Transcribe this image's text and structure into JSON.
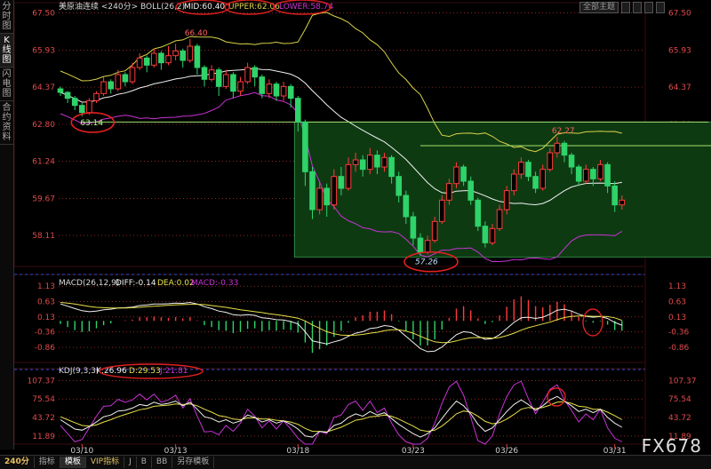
{
  "sidebar_tabs": [
    {
      "label": "分时图",
      "active": false
    },
    {
      "label": "K线图",
      "active": true
    },
    {
      "label": "闪电图",
      "active": false
    },
    {
      "label": "合约资料",
      "active": false
    }
  ],
  "top_controls": {
    "theme_label": "全部主题"
  },
  "bottom_tabs": [
    {
      "label": "240分",
      "kind": "period"
    },
    {
      "label": "指标",
      "kind": "normal"
    },
    {
      "label": "模板",
      "kind": "active"
    },
    {
      "label": "VIP指标",
      "kind": "vip"
    },
    {
      "label": "J",
      "kind": "normal"
    },
    {
      "label": "B",
      "kind": "normal"
    },
    {
      "label": "BB",
      "kind": "normal"
    },
    {
      "label": "另存模板",
      "kind": "normal"
    }
  ],
  "watermark": "FX678",
  "colors": {
    "up": "#ff3b3b",
    "down": "#2fd36a",
    "mid": "#f0f0f0",
    "upper": "#d9d24a",
    "lower": "#c833d6",
    "dif": "#f0f0f0",
    "dea": "#e8e04a",
    "kdj_k": "#f0f0f0",
    "kdj_d": "#e8e04a",
    "kdj_j": "#c833d6",
    "annot": "#e02020",
    "box": "#0e3a12",
    "hline": "#9ee06a"
  },
  "chart_data": [
    {
      "type": "candlestick",
      "title": "美原油连续 <240分> BOLL(26,2)",
      "legend": [
        {
          "label": "MID:60.40",
          "color_key": "mid"
        },
        {
          "label": "UPPER:62.06",
          "color_key": "upper"
        },
        {
          "label": "LOWER:58.74",
          "color_key": "lower"
        }
      ],
      "yticks": [
        "67.50",
        "65.93",
        "64.37",
        "62.80",
        "61.24",
        "59.67",
        "58.11"
      ],
      "ytick_values": [
        67.5,
        65.93,
        64.37,
        62.8,
        61.24,
        59.67,
        58.11
      ],
      "ylim": [
        56.8,
        67.6
      ],
      "dates": [
        "03/10",
        "03/13",
        "03/18",
        "03/23",
        "03/26",
        "03/31"
      ],
      "date_index": [
        3,
        16,
        33,
        49,
        62,
        77
      ],
      "candles": [
        [
          64.3,
          64.15,
          64.4,
          64.0
        ],
        [
          64.15,
          63.9,
          64.2,
          63.7
        ],
        [
          63.9,
          63.6,
          64.0,
          63.4
        ],
        [
          63.6,
          63.3,
          63.7,
          63.14
        ],
        [
          63.3,
          63.8,
          63.9,
          63.2
        ],
        [
          63.8,
          64.1,
          64.2,
          63.7
        ],
        [
          64.1,
          64.6,
          64.8,
          64.0
        ],
        [
          64.6,
          64.3,
          64.7,
          64.1
        ],
        [
          64.3,
          64.9,
          65.1,
          64.2
        ],
        [
          64.9,
          64.6,
          65.0,
          64.4
        ],
        [
          64.6,
          65.2,
          65.4,
          64.5
        ],
        [
          65.2,
          65.6,
          65.8,
          65.1
        ],
        [
          65.6,
          65.3,
          65.7,
          65.0
        ],
        [
          65.3,
          65.8,
          66.0,
          65.2
        ],
        [
          65.8,
          65.4,
          65.9,
          65.1
        ],
        [
          65.4,
          65.7,
          66.1,
          65.3
        ],
        [
          65.7,
          65.9,
          66.2,
          65.5
        ],
        [
          65.9,
          65.5,
          66.0,
          65.2
        ],
        [
          65.5,
          66.1,
          66.4,
          65.4
        ],
        [
          66.1,
          65.2,
          66.2,
          64.9
        ],
        [
          65.2,
          64.7,
          65.3,
          64.4
        ],
        [
          64.7,
          65.1,
          65.3,
          64.6
        ],
        [
          65.1,
          64.4,
          65.2,
          64.0
        ],
        [
          64.4,
          64.9,
          65.1,
          64.3
        ],
        [
          64.9,
          64.2,
          65.0,
          63.9
        ],
        [
          64.2,
          64.6,
          64.8,
          64.0
        ],
        [
          64.6,
          65.2,
          65.4,
          64.5
        ],
        [
          65.2,
          64.8,
          65.3,
          64.4
        ],
        [
          64.8,
          64.1,
          64.9,
          63.9
        ],
        [
          64.1,
          64.5,
          64.7,
          63.9
        ],
        [
          64.5,
          64.0,
          64.6,
          63.8
        ],
        [
          64.0,
          64.4,
          64.6,
          63.8
        ],
        [
          64.4,
          63.9,
          64.5,
          63.5
        ],
        [
          63.9,
          62.9,
          64.0,
          62.5
        ],
        [
          62.9,
          60.8,
          63.0,
          60.2
        ],
        [
          60.8,
          59.2,
          61.0,
          58.8
        ],
        [
          59.2,
          60.1,
          60.4,
          59.0
        ],
        [
          60.1,
          59.4,
          60.3,
          58.9
        ],
        [
          59.4,
          60.6,
          60.9,
          59.2
        ],
        [
          60.6,
          60.1,
          61.0,
          59.8
        ],
        [
          60.1,
          61.1,
          61.4,
          60.0
        ],
        [
          61.1,
          61.3,
          61.6,
          60.8
        ],
        [
          61.3,
          60.9,
          61.5,
          60.6
        ],
        [
          60.9,
          61.5,
          61.8,
          60.7
        ],
        [
          61.5,
          61.0,
          61.7,
          60.7
        ],
        [
          61.0,
          61.4,
          61.6,
          60.8
        ],
        [
          61.4,
          60.6,
          61.5,
          60.3
        ],
        [
          60.6,
          59.8,
          60.8,
          59.5
        ],
        [
          59.8,
          58.9,
          60.0,
          58.6
        ],
        [
          58.9,
          58.0,
          59.1,
          57.7
        ],
        [
          58.0,
          57.4,
          58.2,
          57.26
        ],
        [
          57.4,
          57.9,
          58.1,
          57.3
        ],
        [
          57.9,
          58.7,
          58.9,
          57.8
        ],
        [
          58.7,
          59.6,
          59.8,
          58.6
        ],
        [
          59.6,
          60.3,
          60.5,
          59.4
        ],
        [
          60.3,
          61.0,
          61.2,
          60.1
        ],
        [
          61.0,
          60.4,
          61.1,
          60.2
        ],
        [
          60.4,
          59.6,
          60.6,
          59.4
        ],
        [
          59.6,
          58.5,
          59.7,
          58.3
        ],
        [
          58.5,
          57.8,
          58.7,
          57.6
        ],
        [
          57.8,
          58.4,
          58.6,
          57.7
        ],
        [
          58.4,
          59.2,
          59.4,
          58.3
        ],
        [
          59.2,
          60.0,
          60.2,
          59.0
        ],
        [
          60.0,
          60.7,
          60.9,
          59.8
        ],
        [
          60.7,
          61.2,
          61.4,
          60.5
        ],
        [
          61.2,
          60.6,
          61.3,
          60.4
        ],
        [
          60.6,
          60.1,
          60.8,
          59.9
        ],
        [
          60.1,
          60.9,
          61.1,
          60.0
        ],
        [
          60.9,
          61.6,
          61.8,
          60.8
        ],
        [
          61.6,
          62.0,
          62.27,
          61.4
        ],
        [
          62.0,
          61.5,
          62.1,
          61.2
        ],
        [
          61.5,
          61.0,
          61.6,
          60.7
        ],
        [
          61.0,
          60.4,
          61.1,
          60.2
        ],
        [
          60.4,
          60.9,
          61.1,
          60.3
        ],
        [
          60.9,
          60.5,
          61.0,
          60.2
        ],
        [
          60.5,
          61.1,
          61.3,
          60.4
        ],
        [
          61.1,
          60.2,
          61.2,
          59.9
        ],
        [
          60.2,
          59.4,
          60.4,
          59.1
        ],
        [
          59.4,
          59.6,
          59.8,
          59.2
        ]
      ],
      "annotations": [
        {
          "label": "66.40",
          "index": 18,
          "price": 66.4
        },
        {
          "label": "63.14",
          "index": 3,
          "price": 63.14
        },
        {
          "label": "62.27",
          "index": 69,
          "price": 62.27
        },
        {
          "label": "57.26",
          "index": 50,
          "price": 57.26
        }
      ],
      "hlines": [
        {
          "price": 62.9,
          "from_index": 3,
          "to_index": 90
        },
        {
          "price": 61.9,
          "from_index": 50,
          "to_index": 95
        }
      ],
      "box": {
        "from_index": 33,
        "to_index": 92,
        "top": 62.9,
        "bottom": 57.2
      }
    },
    {
      "type": "macd",
      "title": "MACD(26,12,9)",
      "legend": [
        {
          "label": "DIFF:-0.14",
          "color_key": "dif"
        },
        {
          "label": "DEA:0.02",
          "color_key": "dea"
        },
        {
          "label": "MACD:-0.33",
          "color_key": "lower"
        }
      ],
      "yticks": [
        "1.13",
        "0.63",
        "0.13",
        "-0.36",
        "-0.86"
      ],
      "ytick_values": [
        1.13,
        0.63,
        0.13,
        -0.36,
        -0.86
      ],
      "ylim": [
        -1.35,
        1.25
      ],
      "dif": [
        0.55,
        0.48,
        0.4,
        0.33,
        0.3,
        0.32,
        0.36,
        0.38,
        0.42,
        0.43,
        0.45,
        0.5,
        0.52,
        0.55,
        0.55,
        0.56,
        0.58,
        0.57,
        0.6,
        0.55,
        0.46,
        0.4,
        0.32,
        0.28,
        0.2,
        0.18,
        0.2,
        0.18,
        0.1,
        0.08,
        0.04,
        0.03,
        -0.02,
        -0.1,
        -0.35,
        -0.65,
        -0.7,
        -0.75,
        -0.68,
        -0.62,
        -0.5,
        -0.4,
        -0.35,
        -0.25,
        -0.22,
        -0.15,
        -0.18,
        -0.3,
        -0.5,
        -0.7,
        -0.9,
        -1.0,
        -0.98,
        -0.85,
        -0.65,
        -0.45,
        -0.35,
        -0.38,
        -0.5,
        -0.6,
        -0.58,
        -0.45,
        -0.25,
        -0.05,
        0.1,
        0.12,
        0.08,
        0.12,
        0.22,
        0.35,
        0.38,
        0.32,
        0.22,
        0.15,
        0.12,
        0.14,
        0.08,
        -0.05,
        -0.14
      ],
      "dea": [
        0.6,
        0.58,
        0.55,
        0.51,
        0.47,
        0.44,
        0.43,
        0.42,
        0.42,
        0.42,
        0.43,
        0.44,
        0.46,
        0.48,
        0.49,
        0.51,
        0.52,
        0.53,
        0.54,
        0.54,
        0.53,
        0.5,
        0.47,
        0.44,
        0.4,
        0.36,
        0.33,
        0.3,
        0.27,
        0.23,
        0.2,
        0.17,
        0.13,
        0.09,
        0.0,
        -0.13,
        -0.24,
        -0.35,
        -0.42,
        -0.46,
        -0.47,
        -0.46,
        -0.44,
        -0.4,
        -0.37,
        -0.32,
        -0.29,
        -0.29,
        -0.33,
        -0.4,
        -0.5,
        -0.6,
        -0.68,
        -0.71,
        -0.7,
        -0.65,
        -0.59,
        -0.55,
        -0.54,
        -0.55,
        -0.56,
        -0.54,
        -0.48,
        -0.4,
        -0.3,
        -0.22,
        -0.16,
        -0.1,
        -0.04,
        0.04,
        0.11,
        0.15,
        0.16,
        0.16,
        0.15,
        0.15,
        0.14,
        0.1,
        0.02
      ]
    },
    {
      "type": "kdj",
      "title": "KDJ(9,3,3)",
      "legend": [
        {
          "label": "K:26.96",
          "color_key": "kdj_k"
        },
        {
          "label": "D:29.53",
          "color_key": "kdj_d"
        },
        {
          "label": "J:21.81",
          "color_key": "kdj_j"
        }
      ],
      "yticks": [
        "107.37",
        "75.54",
        "43.72",
        "11.89"
      ],
      "ytick_values": [
        107.37,
        75.54,
        43.72,
        11.89
      ],
      "ylim": [
        -2,
        114
      ],
      "k": [
        40,
        32,
        24,
        22,
        28,
        36,
        45,
        48,
        55,
        56,
        60,
        66,
        64,
        70,
        66,
        68,
        72,
        64,
        70,
        58,
        45,
        42,
        36,
        40,
        34,
        38,
        48,
        44,
        36,
        40,
        34,
        38,
        32,
        24,
        12,
        10,
        20,
        18,
        30,
        34,
        44,
        50,
        46,
        54,
        48,
        52,
        42,
        32,
        24,
        16,
        10,
        16,
        26,
        42,
        58,
        72,
        64,
        50,
        32,
        20,
        26,
        40,
        54,
        66,
        74,
        66,
        56,
        64,
        74,
        80,
        72,
        64,
        54,
        58,
        52,
        58,
        44,
        34,
        27
      ],
      "d": [
        45,
        40,
        35,
        30,
        29,
        31,
        36,
        40,
        45,
        49,
        53,
        57,
        59,
        63,
        64,
        65,
        67,
        66,
        67,
        64,
        58,
        53,
        47,
        45,
        41,
        40,
        43,
        43,
        41,
        41,
        39,
        38,
        36,
        32,
        25,
        20,
        20,
        19,
        23,
        27,
        33,
        39,
        41,
        45,
        46,
        48,
        46,
        41,
        35,
        29,
        22,
        20,
        22,
        29,
        39,
        50,
        55,
        53,
        46,
        37,
        33,
        35,
        41,
        49,
        58,
        61,
        59,
        61,
        65,
        70,
        71,
        68,
        63,
        62,
        58,
        58,
        53,
        47,
        40
      ],
      "j": [
        30,
        16,
        2,
        6,
        26,
        46,
        63,
        64,
        75,
        70,
        74,
        84,
        74,
        84,
        70,
        74,
        82,
        60,
        76,
        46,
        19,
        20,
        14,
        30,
        20,
        34,
        58,
        46,
        26,
        38,
        24,
        38,
        24,
        8,
        -2,
        -5,
        20,
        16,
        44,
        48,
        66,
        72,
        56,
        72,
        52,
        60,
        34,
        14,
        2,
        -5,
        -5,
        8,
        34,
        68,
        96,
        106,
        82,
        44,
        4,
        -4,
        12,
        50,
        80,
        100,
        106,
        76,
        50,
        70,
        92,
        100,
        74,
        56,
        36,
        50,
        40,
        58,
        26,
        8,
        2
      ]
    }
  ]
}
